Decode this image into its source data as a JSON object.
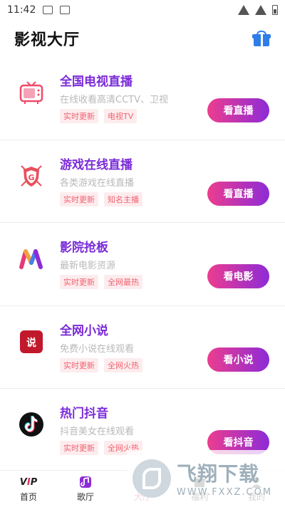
{
  "status": {
    "time": "11:42"
  },
  "header": {
    "title": "影视大厅"
  },
  "items": [
    {
      "name": "全国电视直播",
      "desc": "在线收看高清CCTV、卫视",
      "tags": [
        "实时更新",
        "电视TV"
      ],
      "button": "看直播",
      "icon": "tv-icon"
    },
    {
      "name": "游戏在线直播",
      "desc": "各类游戏在线直播",
      "tags": [
        "实时更新",
        "知名主播"
      ],
      "button": "看直播",
      "icon": "game-shield-icon"
    },
    {
      "name": "影院抢板",
      "desc": "最新电影资源",
      "tags": [
        "实时更新",
        "全网最热"
      ],
      "button": "看电影",
      "icon": "movie-m-icon"
    },
    {
      "name": "全网小说",
      "desc": "免费小说在线观看",
      "tags": [
        "实时更新",
        "全网火热"
      ],
      "button": "看小说",
      "icon": "novel-icon"
    },
    {
      "name": "热门抖音",
      "desc": "抖音美女在线观看",
      "tags": [
        "实时更新",
        "全网火热"
      ],
      "button": "看抖音",
      "icon": "tiktok-icon"
    }
  ],
  "nav": [
    {
      "label": "首页",
      "icon": "vip-icon"
    },
    {
      "label": "歌厅",
      "icon": "music-icon"
    },
    {
      "label": "大厅",
      "icon": "hall-icon"
    },
    {
      "label": "福利",
      "icon": "gift-icon"
    },
    {
      "label": "我的",
      "icon": "profile-icon"
    }
  ],
  "watermark": {
    "main": "飞翔下载",
    "sub": "WWW.FXXZ.COM"
  },
  "colors": {
    "accent_purple": "#7a2bd8",
    "button_start": "#ec3d8f",
    "button_end": "#8d2bd6",
    "tag_text": "#f06270",
    "tag_bg": "#fdecee",
    "gift_blue": "#2f7dea"
  }
}
